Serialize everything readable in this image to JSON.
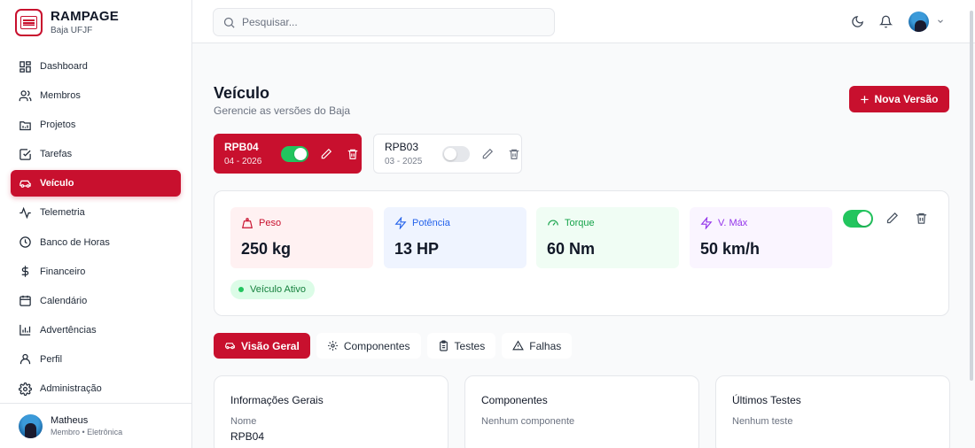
{
  "brand": {
    "title": "RAMPAGE",
    "subtitle": "Baja UFJF",
    "logo_text": "BAJA RAMPAGE"
  },
  "sidebar": {
    "items": [
      {
        "label": "Dashboard",
        "icon": "dashboard-icon"
      },
      {
        "label": "Membros",
        "icon": "users-icon"
      },
      {
        "label": "Projetos",
        "icon": "folder-icon"
      },
      {
        "label": "Tarefas",
        "icon": "checkbox-icon"
      },
      {
        "label": "Veículo",
        "icon": "car-icon",
        "active": true
      },
      {
        "label": "Telemetria",
        "icon": "activity-icon"
      },
      {
        "label": "Banco de Horas",
        "icon": "clock-icon"
      },
      {
        "label": "Financeiro",
        "icon": "dollar-icon"
      },
      {
        "label": "Calendário",
        "icon": "calendar-icon"
      },
      {
        "label": "Advertências",
        "icon": "bar-chart-icon"
      },
      {
        "label": "Perfil",
        "icon": "user-icon"
      },
      {
        "label": "Administração",
        "icon": "gear-icon"
      }
    ],
    "user": {
      "name": "Matheus",
      "role": "Membro • Eletrônica"
    }
  },
  "topbar": {
    "search_placeholder": "Pesquisar..."
  },
  "page": {
    "title": "Veículo",
    "subtitle": "Gerencie as versões do Baja",
    "new_button": "Nova Versão",
    "new_button_icon": "+"
  },
  "versions": [
    {
      "name": "RPB04",
      "date": "04 - 2026",
      "active": true
    },
    {
      "name": "RPB03",
      "date": "03 - 2025",
      "active": false
    }
  ],
  "specs": {
    "peso": {
      "label": "Peso",
      "value": "250 kg"
    },
    "potencia": {
      "label": "Potência",
      "value": "13 HP"
    },
    "torque": {
      "label": "Torque",
      "value": "60 Nm"
    },
    "vmax": {
      "label": "V. Máx",
      "value": "50 km/h"
    },
    "status": "Veículo Ativo"
  },
  "tabs": [
    {
      "label": "Visão Geral",
      "active": true
    },
    {
      "label": "Componentes"
    },
    {
      "label": "Testes"
    },
    {
      "label": "Falhas"
    }
  ],
  "panels": {
    "info": {
      "title": "Informações Gerais",
      "label": "Nome",
      "value": "RPB04"
    },
    "components": {
      "title": "Componentes",
      "empty": "Nenhum componente"
    },
    "tests": {
      "title": "Últimos Testes",
      "empty": "Nenhum teste"
    }
  },
  "colors": {
    "brand": "#c8102e",
    "active_toggle": "#22c55e"
  }
}
